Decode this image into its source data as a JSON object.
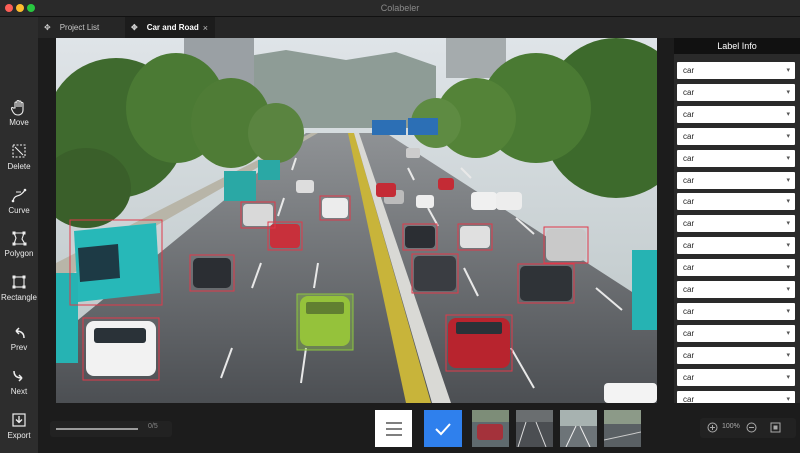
{
  "window": {
    "title": "Colabeler"
  },
  "tabs": [
    {
      "label": "Project List",
      "icon": "gear-icon"
    },
    {
      "label": "Car and Road",
      "icon": "gear-icon",
      "close": "×"
    }
  ],
  "tools": [
    {
      "label": "Move",
      "icon": "hand-icon"
    },
    {
      "label": "Delete",
      "icon": "delete-icon"
    },
    {
      "label": "Curve",
      "icon": "curve-icon"
    },
    {
      "label": "Polygon",
      "icon": "polygon-icon"
    },
    {
      "label": "Rectangle",
      "icon": "rectangle-icon"
    },
    {
      "label": "Prev",
      "icon": "prev-arrow-icon"
    },
    {
      "label": "Next",
      "icon": "next-arrow-icon"
    },
    {
      "label": "Export",
      "icon": "export-icon"
    }
  ],
  "panel": {
    "title": "Label Info",
    "labels": [
      "car",
      "car",
      "car",
      "car",
      "car",
      "car",
      "car",
      "car",
      "car",
      "car",
      "car",
      "car",
      "car",
      "car",
      "car",
      "car"
    ]
  },
  "bottom": {
    "progress_text": "0/5",
    "progress_fraction": 1.0,
    "zoom_text": "100%"
  },
  "colors": {
    "accent": "#2f80ed",
    "box_red": "#e0394a",
    "highlight_green": "#8cc63f"
  }
}
